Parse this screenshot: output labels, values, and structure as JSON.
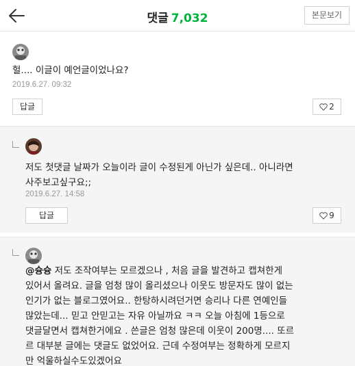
{
  "header": {
    "title": "댓글",
    "count": "7,032",
    "view_post_label": "본문보기"
  },
  "comments": [
    {
      "text": "헐.... 이글이 예언글이었나요?",
      "date": "2019.6.27. 09:32",
      "reply_label": "답글",
      "likes": "2"
    }
  ],
  "replies": [
    {
      "text_line1": "저도 첫댓글 날짜가 오늘이라 글이 수정된게 아닌가 싶은데.. 아니라면",
      "text_line2": "사주보고싶구요;;",
      "date": "2019.6.27. 14:58",
      "reply_label": "답글",
      "likes": "9"
    },
    {
      "mention": "@슝슝",
      "text_line1": "  저도 조작여부는 모르겠으나 , 처음 글을 발견하고 캡쳐한게",
      "text_line2": "있어서 올려요. 글을 엄청 많이 올리셨으나 이웃도 방문자도 많이 없는",
      "text_line3": "인기가 없는 블로그였어요.. 한탕하시려던거면 승리나 다른 연예인들",
      "text_line4": "많았는데... 믿고 안믿고는 자유 아닐까요 ㅋㅋ 오늘 아침에 1등으로",
      "text_line5": "댓글달면서 캡쳐한거에요 . 쓴글은 엄청 많은데 이웃이 200명.... 또르",
      "text_line6": "르 대부분 글에는 댓글도 없었어요. 근데 수정여부는 정확하게 모르지",
      "text_line7": "만 억울하실수도있겠어요"
    }
  ],
  "colors": {
    "accent": "#00b33c",
    "muted": "#999999",
    "reply_bg": "#f5f5f5"
  }
}
